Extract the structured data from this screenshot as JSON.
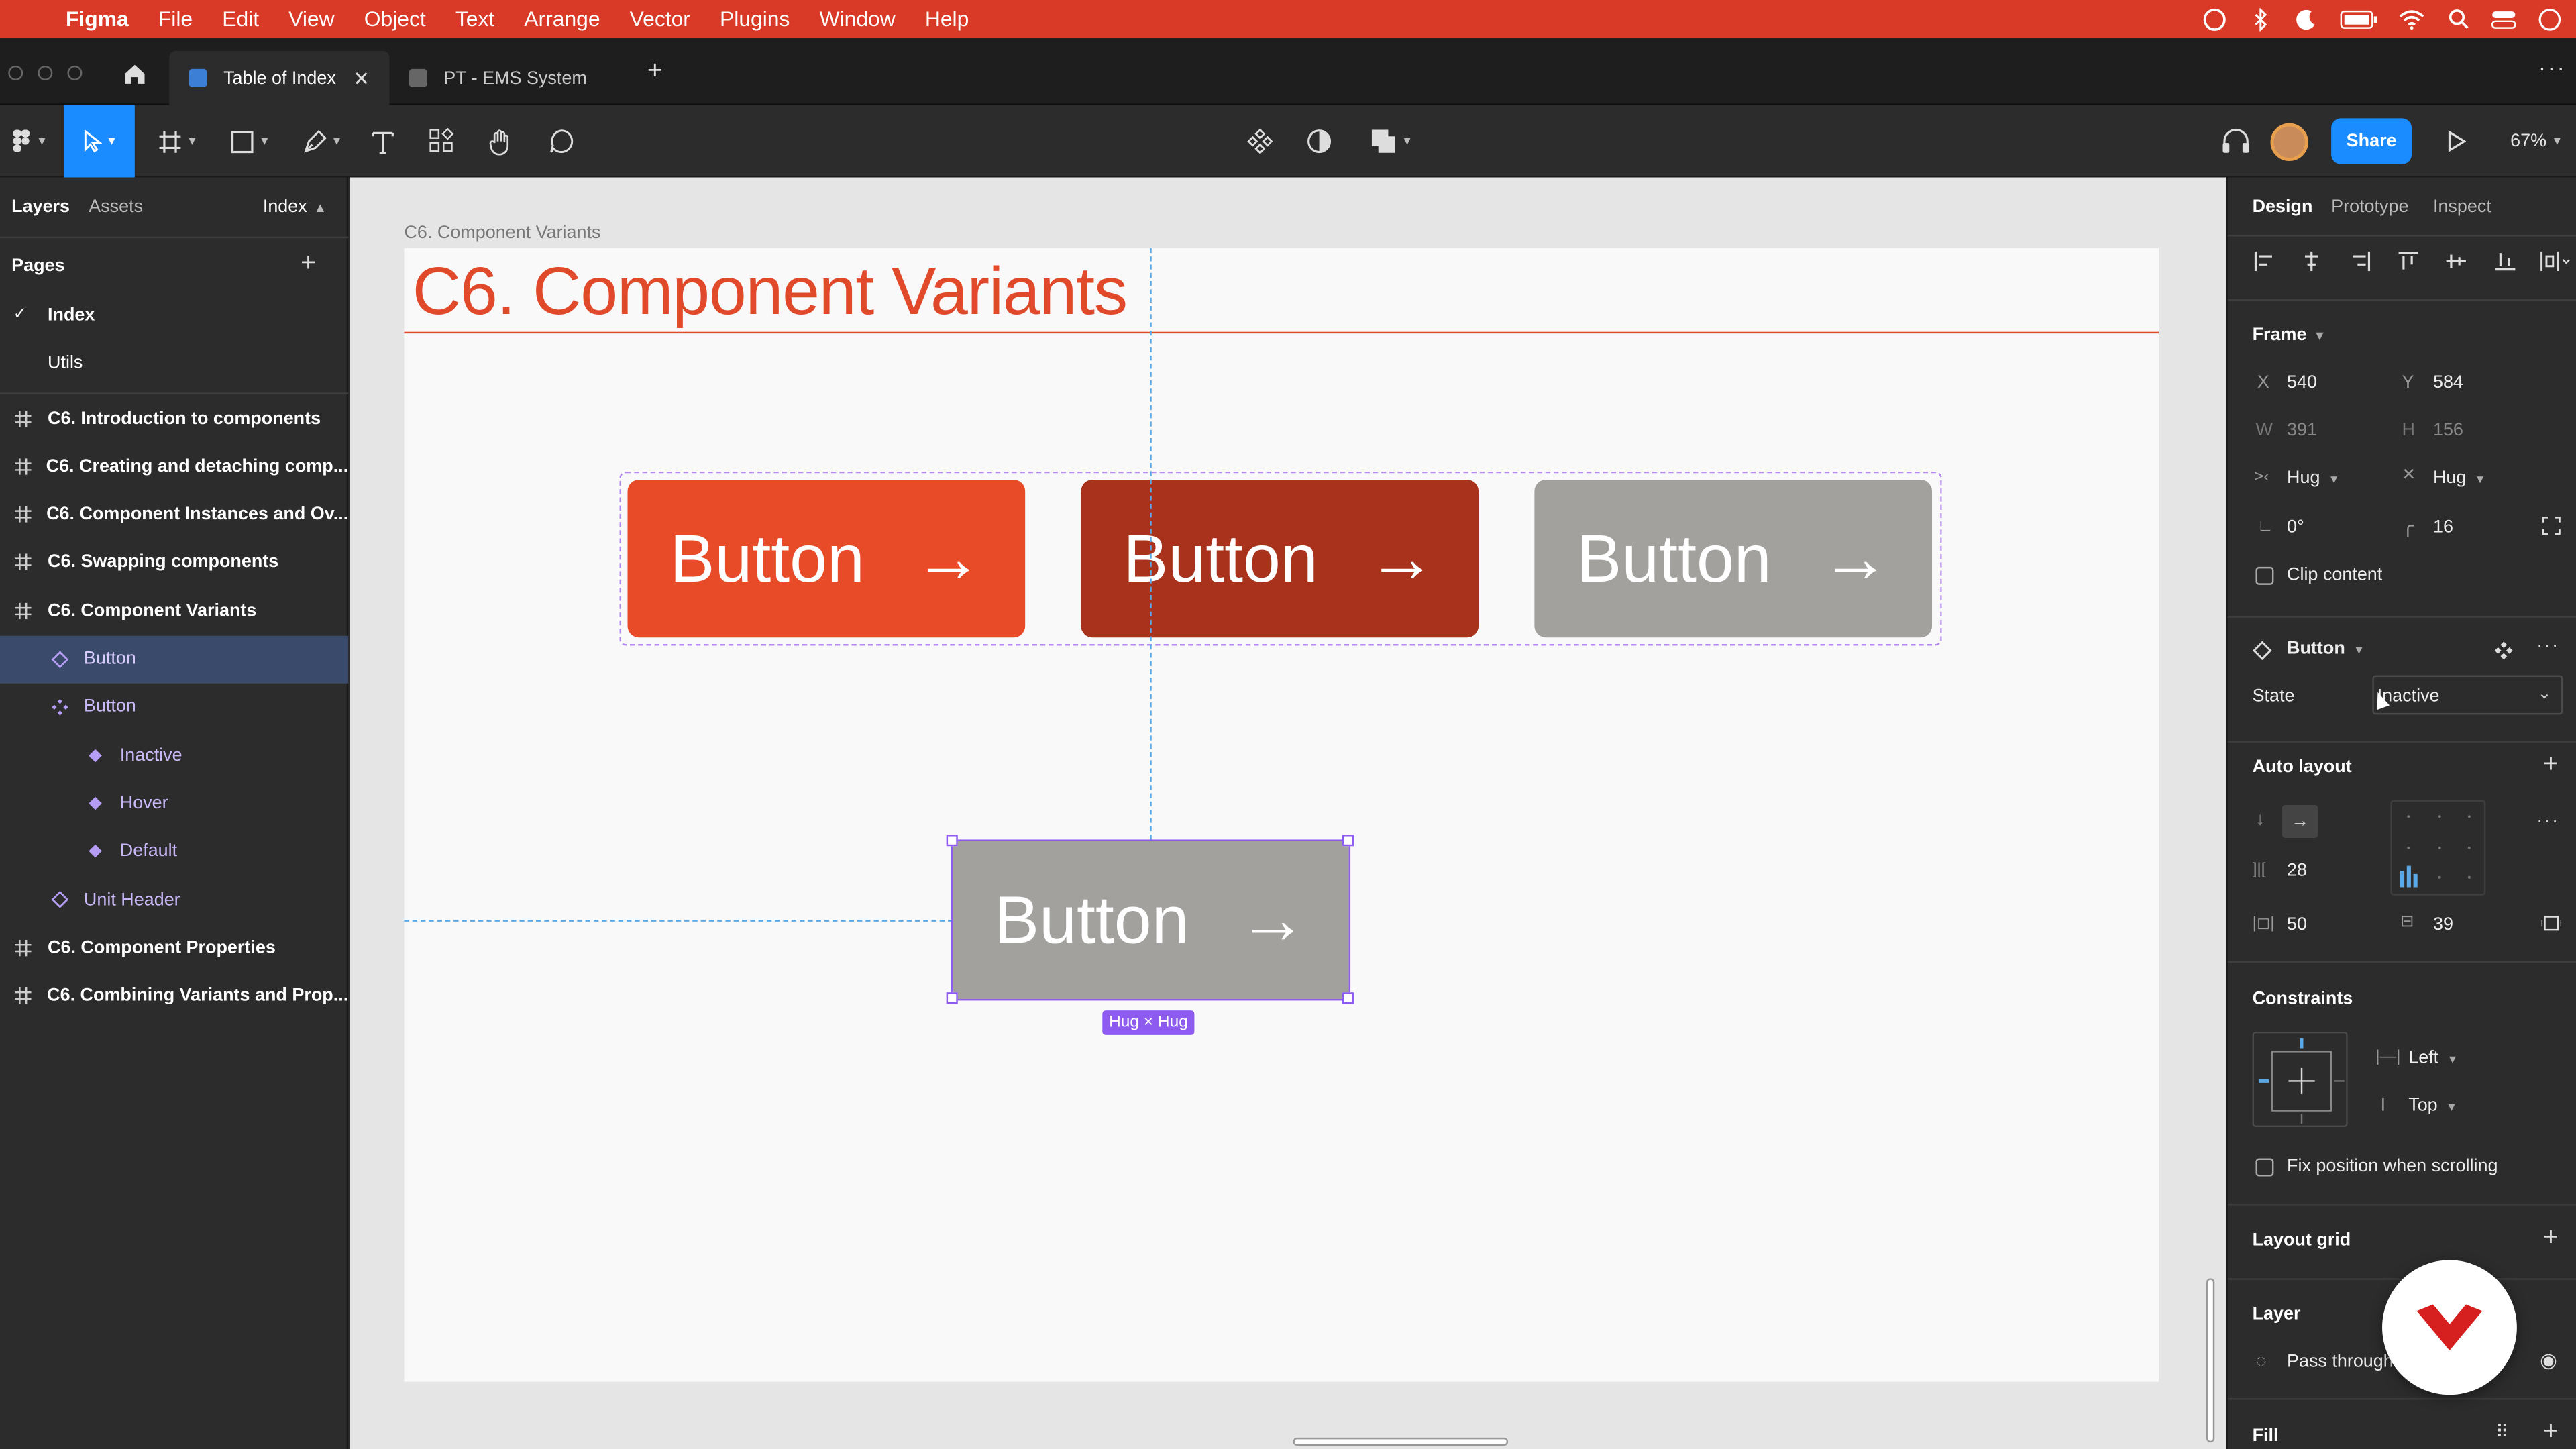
{
  "menubar": {
    "app": "Figma",
    "items": [
      "File",
      "Edit",
      "View",
      "Object",
      "Text",
      "Arrange",
      "Vector",
      "Plugins",
      "Window",
      "Help"
    ]
  },
  "tabs": [
    {
      "label": "Table of Index",
      "active": true
    },
    {
      "label": "PT - EMS System",
      "active": false
    }
  ],
  "toolbar": {
    "share_label": "Share",
    "zoom": "67%"
  },
  "left_panel": {
    "tabs": [
      "Layers",
      "Assets"
    ],
    "page_selector": "Index",
    "pages_title": "Pages",
    "pages": [
      {
        "label": "Index",
        "current": true
      },
      {
        "label": "Utils",
        "current": false
      }
    ],
    "layers": [
      {
        "label": "C6. Introduction to components",
        "icon": "frame-icon",
        "indent": 0,
        "bold": true
      },
      {
        "label": "C6. Creating and detaching comp...",
        "icon": "frame-icon",
        "indent": 0,
        "bold": true
      },
      {
        "label": "C6. Component Instances and Ov...",
        "icon": "frame-icon",
        "indent": 0,
        "bold": true
      },
      {
        "label": "C6. Swapping components",
        "icon": "frame-icon",
        "indent": 0,
        "bold": true
      },
      {
        "label": "C6. Component Variants",
        "icon": "frame-icon",
        "indent": 0,
        "bold": true
      },
      {
        "label": "Button",
        "icon": "instance-icon",
        "indent": 1,
        "bold": false,
        "selected": true
      },
      {
        "label": "Button",
        "icon": "component-set-icon",
        "indent": 1,
        "bold": false
      },
      {
        "label": "Inactive",
        "icon": "component-icon",
        "indent": 2,
        "bold": false
      },
      {
        "label": "Hover",
        "icon": "component-icon",
        "indent": 2,
        "bold": false
      },
      {
        "label": "Default",
        "icon": "component-icon",
        "indent": 2,
        "bold": false
      },
      {
        "label": "Unit Header",
        "icon": "instance-icon",
        "indent": 1,
        "bold": false
      },
      {
        "label": "C6. Component Properties",
        "icon": "frame-icon",
        "indent": 0,
        "bold": true
      },
      {
        "label": "C6. Combining Variants and Prop...",
        "icon": "frame-icon",
        "indent": 0,
        "bold": true
      }
    ]
  },
  "canvas": {
    "frame_label": "C6. Component Variants",
    "title": "C6.  Component Variants",
    "button_label": "Button",
    "button_arrow": "→",
    "variant_colors": [
      "#e84b27",
      "#a8321b",
      "#a3a19e"
    ],
    "instance_color": "#a3a19e",
    "size_badge": "Hug × Hug"
  },
  "right_panel": {
    "tabs": [
      "Design",
      "Prototype",
      "Inspect"
    ],
    "frame_section": "Frame",
    "x": "540",
    "y": "584",
    "w": "391",
    "h": "156",
    "x_label": "X",
    "y_label": "Y",
    "w_label": "W",
    "h_label": "H",
    "h_resize": "Hug",
    "v_resize": "Hug",
    "rotation": "0°",
    "radius": "16",
    "clip_content": "Clip content",
    "component_name": "Button",
    "state_label": "State",
    "state_value": "Inactive",
    "auto_layout": "Auto layout",
    "spacing": "28",
    "padding_h": "50",
    "padding_v": "39",
    "constraints": "Constraints",
    "constraint_h": "Left",
    "constraint_v": "Top",
    "fix_position": "Fix position when scrolling",
    "layout_grid": "Layout grid",
    "layer": "Layer",
    "blend": "Pass through",
    "fill": "Fill"
  }
}
